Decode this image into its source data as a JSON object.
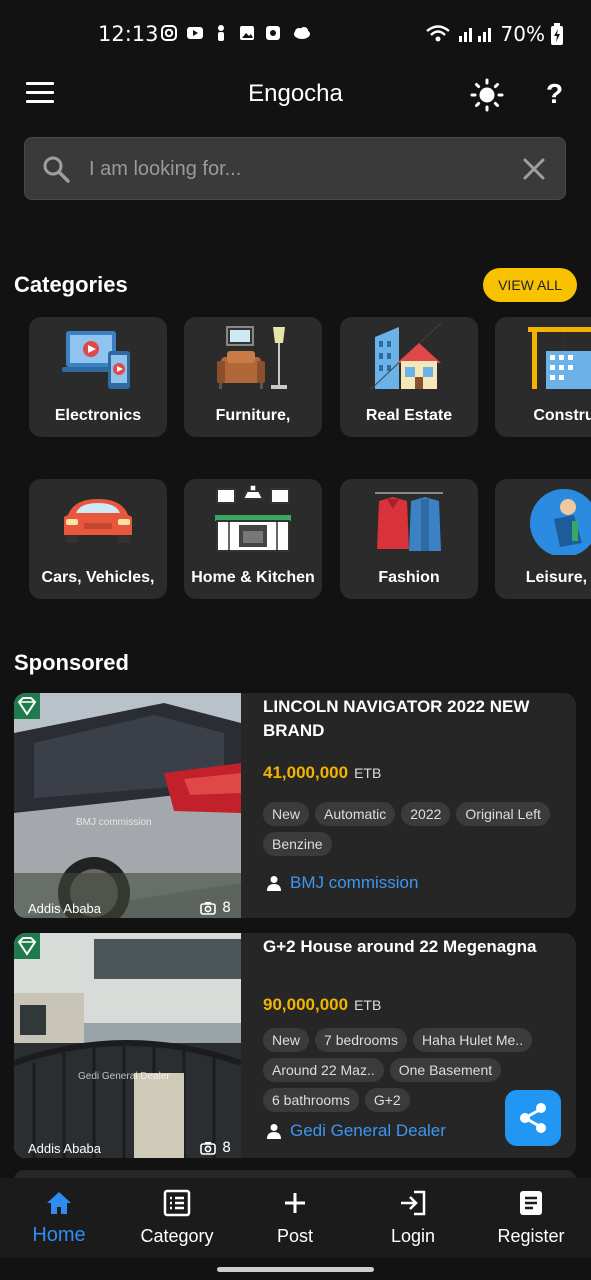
{
  "status_bar": {
    "time": "12:13",
    "battery": "70%",
    "icons": [
      "instagram-icon",
      "youtube-icon",
      "figure-icon",
      "gallery-icon",
      "app-icon",
      "cloud-icon",
      "wifi-icon",
      "signal-icon",
      "battery-icon"
    ]
  },
  "app_bar": {
    "title": "Engocha",
    "help": "?"
  },
  "search": {
    "placeholder": "I am looking for..."
  },
  "categories": {
    "title": "Categories",
    "view_all": "VIEW ALL",
    "row1": [
      "Electronics",
      "Furniture,",
      "Real Estate",
      "Constru"
    ],
    "row2": [
      "Cars, Vehicles,",
      "Home & Kitchen",
      "Fashion",
      "Leisure, S"
    ]
  },
  "sponsored": {
    "title": "Sponsored",
    "listings": [
      {
        "title": "LINCOLN NAVIGATOR 2022 NEW BRAND",
        "price": "41,000,000",
        "currency": "ETB",
        "tags": [
          "New",
          "Automatic",
          "2022",
          "Original Left",
          "Benzine"
        ],
        "seller": "BMJ commission",
        "location": "Addis Ababa",
        "photo_count": "8",
        "watermark": "BMJ commission"
      },
      {
        "title": "G+2 House around 22 Megenagna",
        "price": "90,000,000",
        "currency": "ETB",
        "tags": [
          "New",
          "7 bedrooms",
          "Haha Hulet Me..",
          "Around 22 Maz..",
          "One Basement",
          "6 bathrooms",
          "G+2"
        ],
        "seller": "Gedi General Dealer",
        "location": "Addis Ababa",
        "photo_count": "8",
        "watermark": "Gedi General Dealer"
      }
    ]
  },
  "bottom_nav": {
    "items": [
      {
        "label": "Home",
        "icon": "home-icon",
        "active": true
      },
      {
        "label": "Category",
        "icon": "list-icon",
        "active": false
      },
      {
        "label": "Post",
        "icon": "plus-icon",
        "active": false
      },
      {
        "label": "Login",
        "icon": "login-icon",
        "active": false
      },
      {
        "label": "Register",
        "icon": "register-icon",
        "active": false
      }
    ]
  },
  "colors": {
    "background": "#121212",
    "accent_yellow": "#f9c200",
    "price": "#f2b500",
    "link_blue": "#3d97f2",
    "fab_blue": "#2196f3"
  }
}
